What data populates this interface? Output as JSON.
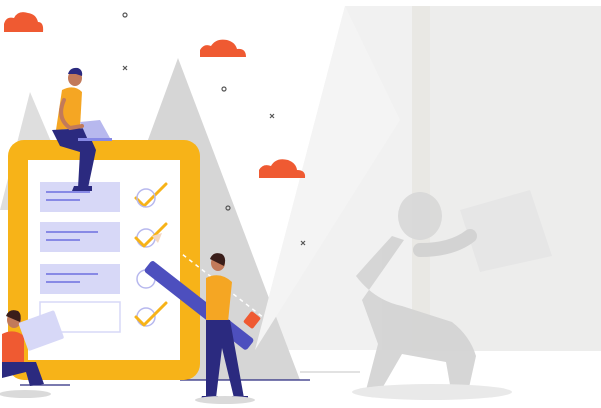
{
  "illustration": {
    "subject": "task-checklist-illustration",
    "colors": {
      "clipboard_frame": "#F7B318",
      "paper": "#FFFFFF",
      "task_row": "#D7D8F7",
      "task_line": "#8789E5",
      "check": "#F7B318",
      "cloud": "#EF5A32",
      "person_shirt": "#F5A623",
      "person_pants": "#2B2A7F",
      "pencil_body": "#4D4FBE",
      "pencil_tip": "#EF5A32",
      "mountain": "#D4D4D4",
      "ghost_figure": "#DADADA",
      "background_panel": "#EFEFEF"
    },
    "checklist": [
      {
        "done": true
      },
      {
        "done": true
      },
      {
        "done": false
      },
      {
        "done": true
      }
    ]
  }
}
